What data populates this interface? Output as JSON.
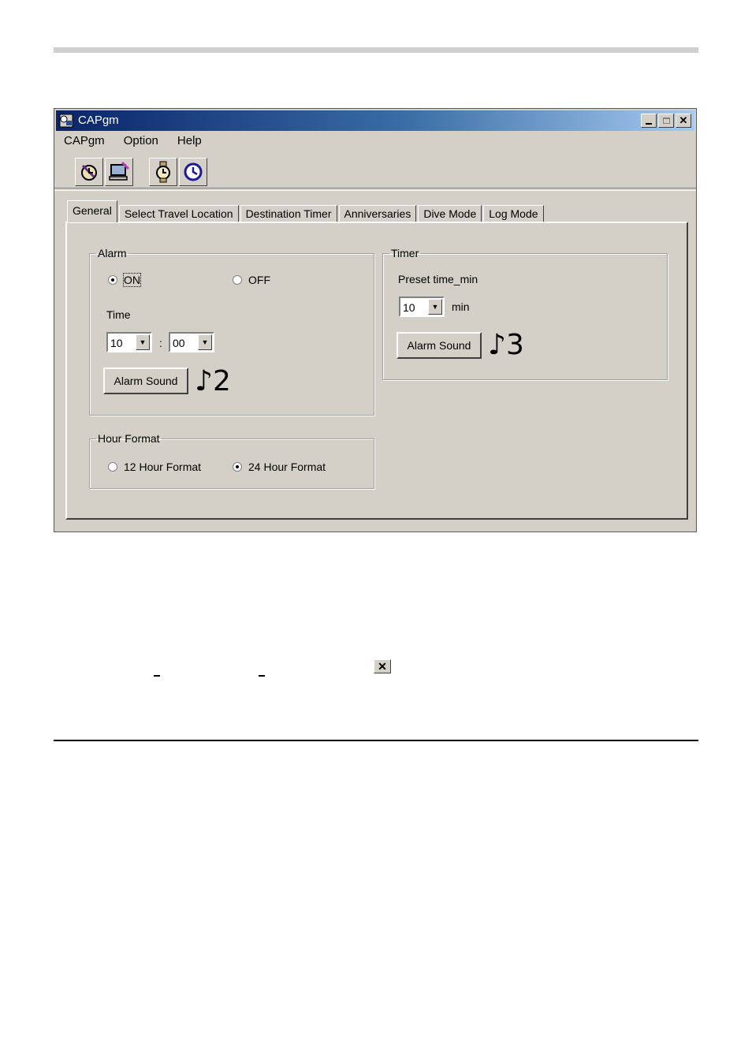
{
  "window": {
    "title": "CAPgm",
    "close_glyph": "✕"
  },
  "menu": [
    "CAPgm",
    "Option",
    "Help"
  ],
  "toolbar": {
    "icons": [
      "watch-upload-icon",
      "computer-download-icon",
      "watch-settings-icon",
      "clock-icon"
    ]
  },
  "tabs": [
    "General",
    "Select Travel Location",
    "Destination Timer",
    "Anniversaries",
    "Dive Mode",
    "Log Mode"
  ],
  "active_tab": "General",
  "alarm": {
    "legend": "Alarm",
    "on_label": "ON",
    "off_label": "OFF",
    "selected": "ON",
    "time_label": "Time",
    "hour": "10",
    "separator": ":",
    "minute": "00",
    "sound_button": "Alarm Sound",
    "sound_note": "♪2"
  },
  "hour_format": {
    "legend": "Hour Format",
    "option_12": "12 Hour Format",
    "option_24": "24 Hour Format",
    "selected": "24 Hour Format"
  },
  "timer": {
    "legend": "Timer",
    "preset_label": "Preset time_min",
    "preset_value": "10",
    "unit": "min",
    "sound_button": "Alarm Sound",
    "sound_note": "♪3"
  },
  "colors": {
    "titlebar_start": "#0a246a",
    "titlebar_end": "#a6caf0",
    "face": "#d4d0c8"
  }
}
